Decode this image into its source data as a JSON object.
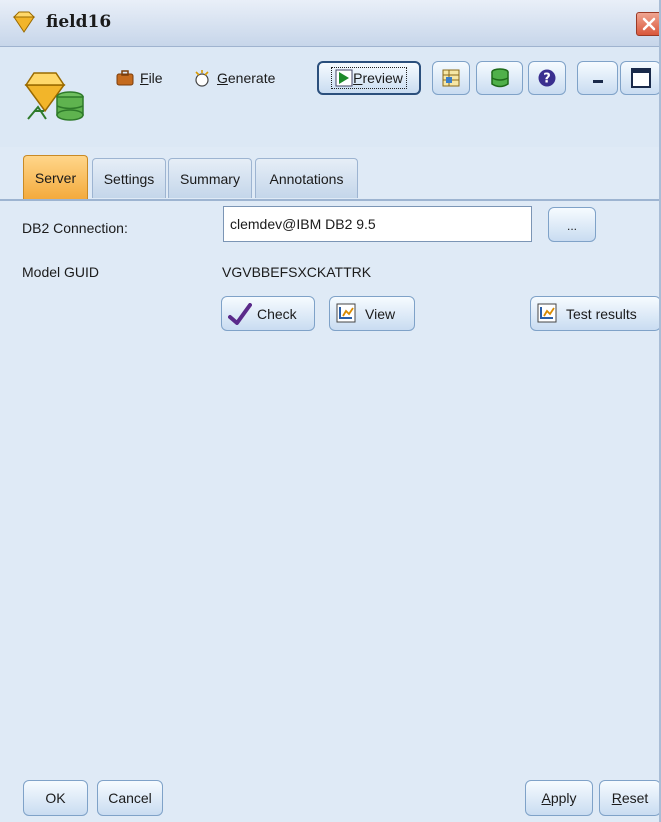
{
  "window": {
    "title": "field16"
  },
  "toolbar": {
    "file_label_first": "F",
    "file_label_rest": "ile",
    "generate_label_first": "G",
    "generate_label_rest": "enerate",
    "preview_label_first": "P",
    "preview_label_rest": "review"
  },
  "tabs": [
    {
      "label": "Server",
      "active": true
    },
    {
      "label": "Settings",
      "active": false
    },
    {
      "label": "Summary",
      "active": false
    },
    {
      "label": "Annotations",
      "active": false
    }
  ],
  "server": {
    "connection_label": "DB2 Connection:",
    "connection_value": "clemdev@IBM DB2 9.5",
    "browse_label": "...",
    "model_guid_label": "Model GUID",
    "model_guid_value": "VGVBBEFSXCKATTRK",
    "check_label": "Check",
    "view_label": "View",
    "test_results_label": "Test results"
  },
  "buttons": {
    "ok": "OK",
    "cancel": "Cancel",
    "apply_first": "A",
    "apply_rest": "pply",
    "reset_first": "R",
    "reset_rest": "eset"
  },
  "colors": {
    "accent_tab": "#f3a93b",
    "close": "#d9573b",
    "background": "#dfeaf6"
  }
}
